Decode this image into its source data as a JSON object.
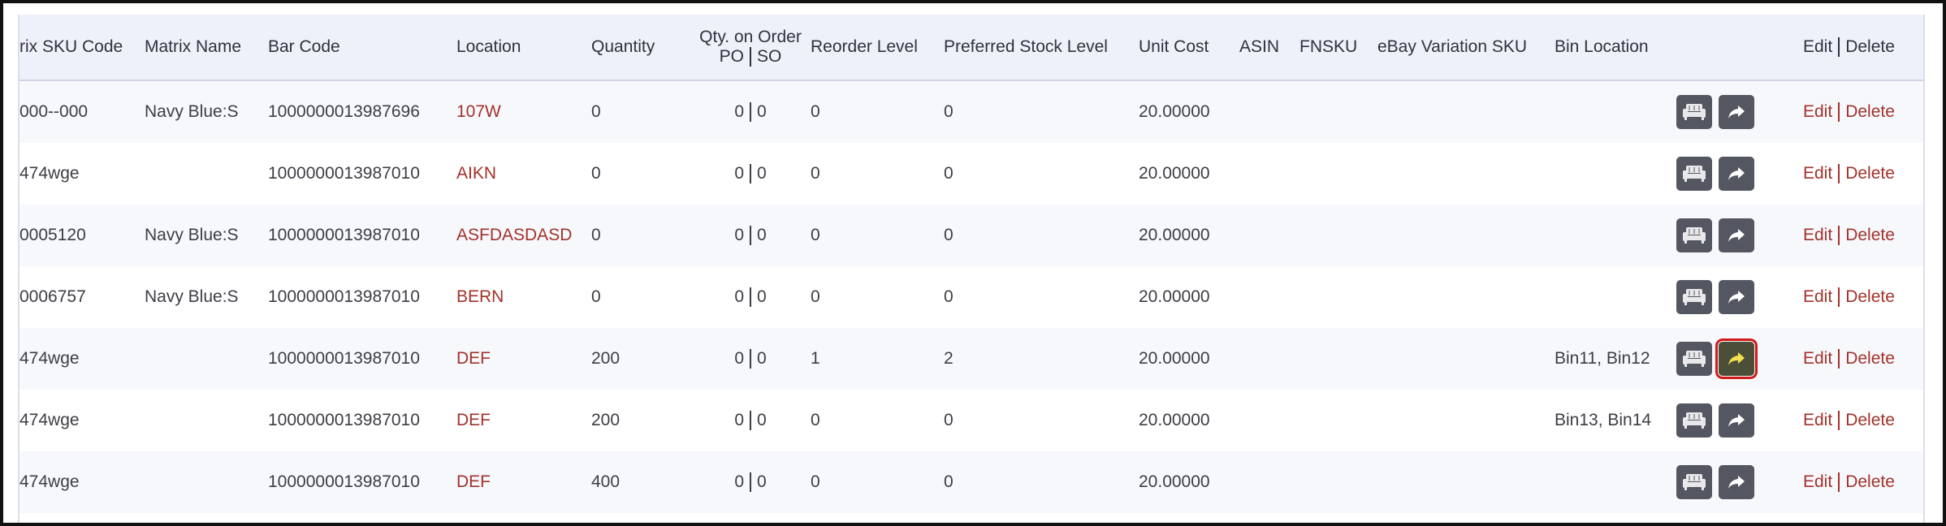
{
  "table": {
    "columns": {
      "matrix_sku": "rix SKU Code",
      "matrix_name": "Matrix Name",
      "bar_code": "Bar Code",
      "location": "Location",
      "quantity": "Quantity",
      "qty_on_order_line1": "Qty. on Order",
      "qty_on_order_po": "PO",
      "qty_on_order_so": "SO",
      "reorder_level": "Reorder Level",
      "preferred_stock": "Preferred Stock Level",
      "unit_cost": "Unit Cost",
      "asin": "ASIN",
      "fnsku": "FNSKU",
      "ebay_sku": "eBay Variation SKU",
      "bin_location": "Bin Location",
      "edit": "Edit",
      "delete": "Delete"
    },
    "rows": [
      {
        "sku": "000--000",
        "name": "Navy Blue:S",
        "barcode": "1000000013987696",
        "location": "107W",
        "quantity": "0",
        "po": "0",
        "so": "0",
        "reorder": "0",
        "preferred": "0",
        "unit_cost": "20.00000",
        "asin": "",
        "fnsku": "",
        "ebay": "",
        "bin": "",
        "edit": "Edit",
        "delete": "Delete"
      },
      {
        "sku": "474wge",
        "name": "",
        "barcode": "1000000013987010",
        "location": "AIKN",
        "quantity": "0",
        "po": "0",
        "so": "0",
        "reorder": "0",
        "preferred": "0",
        "unit_cost": "20.00000",
        "asin": "",
        "fnsku": "",
        "ebay": "",
        "bin": "",
        "edit": "Edit",
        "delete": "Delete"
      },
      {
        "sku": "0005120",
        "name": "Navy Blue:S",
        "barcode": "1000000013987010",
        "location": "ASFDASDASD",
        "quantity": "0",
        "po": "0",
        "so": "0",
        "reorder": "0",
        "preferred": "0",
        "unit_cost": "20.00000",
        "asin": "",
        "fnsku": "",
        "ebay": "",
        "bin": "",
        "edit": "Edit",
        "delete": "Delete"
      },
      {
        "sku": "0006757",
        "name": "Navy Blue:S",
        "barcode": "1000000013987010",
        "location": "BERN",
        "quantity": "0",
        "po": "0",
        "so": "0",
        "reorder": "0",
        "preferred": "0",
        "unit_cost": "20.00000",
        "asin": "",
        "fnsku": "",
        "ebay": "",
        "bin": "",
        "edit": "Edit",
        "delete": "Delete"
      },
      {
        "sku": "474wge",
        "name": "",
        "barcode": "1000000013987010",
        "location": "DEF",
        "quantity": "200",
        "po": "0",
        "so": "0",
        "reorder": "1",
        "preferred": "2",
        "unit_cost": "20.00000",
        "asin": "",
        "fnsku": "",
        "ebay": "",
        "bin": "Bin11, Bin12",
        "edit": "Edit",
        "delete": "Delete"
      },
      {
        "sku": "474wge",
        "name": "",
        "barcode": "1000000013987010",
        "location": "DEF",
        "quantity": "200",
        "po": "0",
        "so": "0",
        "reorder": "0",
        "preferred": "0",
        "unit_cost": "20.00000",
        "asin": "",
        "fnsku": "",
        "ebay": "",
        "bin": "Bin13, Bin14",
        "edit": "Edit",
        "delete": "Delete"
      },
      {
        "sku": "474wge",
        "name": "",
        "barcode": "1000000013987010",
        "location": "DEF",
        "quantity": "400",
        "po": "0",
        "so": "0",
        "reorder": "0",
        "preferred": "0",
        "unit_cost": "20.00000",
        "asin": "",
        "fnsku": "",
        "ebay": "",
        "bin": "",
        "edit": "Edit",
        "delete": "Delete"
      }
    ]
  },
  "icons": {
    "bin_button": "sofa-icon",
    "transfer_button": "share-arrow-icon"
  },
  "colors": {
    "link": "#a3322b",
    "header_bg": "#eff1fa",
    "button_bg": "#545761",
    "highlight_outline": "#d11a1a"
  },
  "highlighted_row_index": 4
}
